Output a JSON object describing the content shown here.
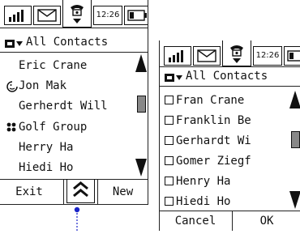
{
  "left_screen": {
    "status": {
      "time": "12:26"
    },
    "header": {
      "title": "All Contacts"
    },
    "contacts": [
      {
        "name": "Eric Crane",
        "icon": ""
      },
      {
        "name": "Jon Mak",
        "icon": "smiley-icon"
      },
      {
        "name": "Gerherdt Will",
        "icon": ""
      },
      {
        "name": "Golf Group",
        "icon": "group-icon"
      },
      {
        "name": "Herry Ha",
        "icon": ""
      },
      {
        "name": "Hiedi Ho",
        "icon": ""
      }
    ],
    "bottom": {
      "left_label": "Exit",
      "right_label": "New"
    }
  },
  "right_screen": {
    "status": {
      "time": "12:26"
    },
    "header": {
      "title": "All Contacts"
    },
    "contacts": [
      {
        "name": "Fran Crane"
      },
      {
        "name": "Franklin Be"
      },
      {
        "name": "Gerhardt Wi"
      },
      {
        "name": "Gomer Ziegf"
      },
      {
        "name": "Henry Ha"
      },
      {
        "name": "Hiedi Ho"
      }
    ],
    "bottom": {
      "left_label": "Cancel",
      "right_label": "OK"
    }
  },
  "colors": {
    "indicator": "#1a24c8"
  }
}
